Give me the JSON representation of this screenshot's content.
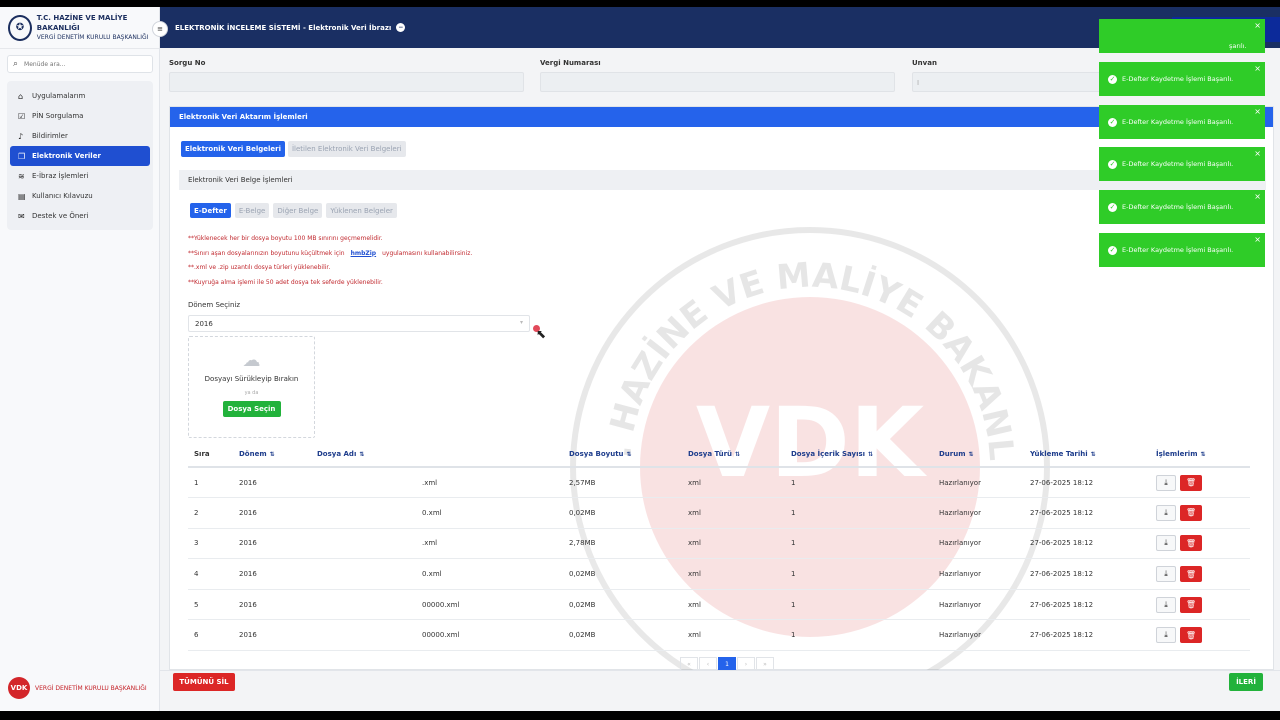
{
  "sidebar": {
    "logo_line1": "T.C. HAZİNE VE MALİYE BAKANLIĞI",
    "logo_line2": "VERGİ DENETİM KURULU BAŞKANLIĞI",
    "search_placeholder": "Menüde ara...",
    "items": [
      {
        "label": "Uygulamalarım",
        "icon": "home-icon"
      },
      {
        "label": "PİN Sorgulama",
        "icon": "check-square-icon"
      },
      {
        "label": "Bildirimler",
        "icon": "bell-icon"
      },
      {
        "label": "Elektronik Veriler",
        "icon": "files-icon",
        "active": true
      },
      {
        "label": "E-İbraz İşlemleri",
        "icon": "layers-icon"
      },
      {
        "label": "Kullanıcı Kılavuzu",
        "icon": "doc-icon"
      },
      {
        "label": "Destek ve Öneri",
        "icon": "mail-icon"
      }
    ],
    "footer": "VERGİ DENETİM KURULU BAŞKANLIĞI",
    "footer_logo": "VDK"
  },
  "topbar": {
    "title": "ELEKTRONİK İNCELEME SİSTEMİ - Elektronik Veri İbrazı"
  },
  "fields": {
    "sorgu_label": "Sorgu No",
    "vergi_label": "Vergi Numarası",
    "unvan_label": "Unvan",
    "unvan_value": "I"
  },
  "panel": {
    "title": "Elektronik Veri Aktarım İşlemleri",
    "tabs": [
      "Elektronik Veri Belgeleri",
      "İletilen Elektronik Veri Belgeleri"
    ],
    "sub_title": "Elektronik Veri Belge İşlemleri",
    "sub_tabs": [
      "E-Defter",
      "E-Belge",
      "Diğer Belge",
      "Yüklenen Belgeler"
    ],
    "notes": [
      "**Yüklenecek her bir dosya boyutu 100 MB sınırını geçmemelidir.",
      "**Sınırı aşan dosyalarınızın boyutunu küçültmek için",
      "hmbZip",
      "uygulamasını kullanabilirsiniz.",
      "**.xml ve .zip uzantılı dosya türleri yüklenebilir.",
      "**Kuyruğa alma işlemi ile 50 adet dosya tek seferde yüklenebilir."
    ],
    "donem_label": "Dönem Seçiniz",
    "donem_value": "2016",
    "drop_text": "Dosyayı Sürükleyip Bırakın",
    "drop_or": "ya da",
    "drop_button": "Dosya Seçin"
  },
  "table": {
    "headers": [
      "Sıra",
      "Dönem",
      "Dosya Adı",
      "Dosya Boyutu",
      "Dosya Türü",
      "Dosya İçerik Sayısı",
      "Durum",
      "Yükleme Tarihi",
      "İşlemlerim"
    ],
    "rows": [
      [
        "1",
        "2016",
        ".xml",
        "2,57MB",
        "xml",
        "1",
        "Hazırlanıyor",
        "27-06-2025 18:12"
      ],
      [
        "2",
        "2016",
        "0.xml",
        "0,02MB",
        "xml",
        "1",
        "Hazırlanıyor",
        "27-06-2025 18:12"
      ],
      [
        "3",
        "2016",
        ".xml",
        "2,78MB",
        "xml",
        "1",
        "Hazırlanıyor",
        "27-06-2025 18:12"
      ],
      [
        "4",
        "2016",
        "0.xml",
        "0,02MB",
        "xml",
        "1",
        "Hazırlanıyor",
        "27-06-2025 18:12"
      ],
      [
        "5",
        "2016",
        "00000.xml",
        "0,02MB",
        "xml",
        "1",
        "Hazırlanıyor",
        "27-06-2025 18:12"
      ],
      [
        "6",
        "2016",
        "00000.xml",
        "0,02MB",
        "xml",
        "1",
        "Hazırlanıyor",
        "27-06-2025 18:12"
      ]
    ]
  },
  "pager": {
    "current": "1"
  },
  "bottom": {
    "delete_all": "TÜMÜNÜ SİL",
    "next": "İLERİ"
  },
  "toasts": [
    "E-Defter Kaydetme İşlemi Başarılı.",
    "E-Defter Kaydetme İşlemi Başarılı.",
    "E-Defter Kaydetme İşlemi Başarılı.",
    "E-Defter Kaydetme İşlemi Başarılı.",
    "E-Defter Kaydetme İşlemi Başarılı.",
    "E-Defter Kaydetme İşlemi Başarılı."
  ],
  "toast_partial": "şarılı.",
  "watermark": {
    "text": "VDK",
    "ring_text": "T.C. HAZİNE VE MALİYE BAKANLIĞI"
  },
  "colors": {
    "accent": "#2563eb",
    "topbar": "#1a2f63",
    "success": "#2fcc28",
    "danger": "#dc2626"
  }
}
